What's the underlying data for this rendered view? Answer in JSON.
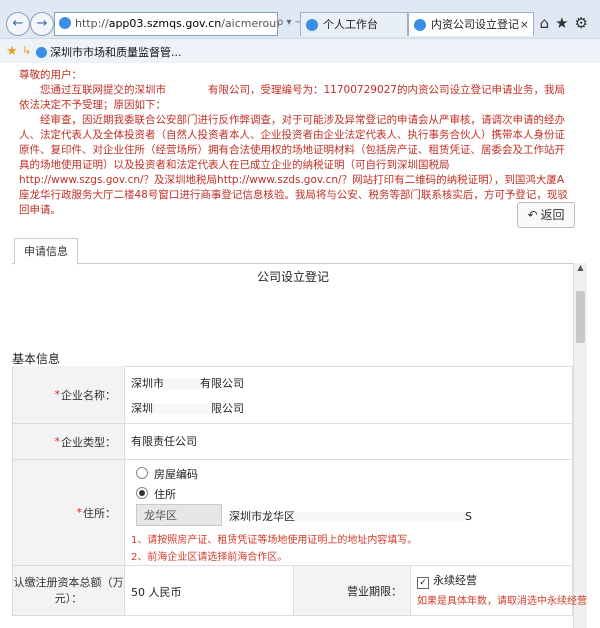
{
  "browser": {
    "back_glyph": "←",
    "forward_glyph": "→",
    "address_prefix": "http://",
    "address_host": "app03.szmqs.gov.cn",
    "address_path": "/aicmerout/jsp/·",
    "address_tools": "ρ ▾ → C",
    "tabs": [
      {
        "label": "个人工作台"
      },
      {
        "label": "内资公司设立登记",
        "active": true
      }
    ],
    "tab_close": "×",
    "toolbar_icons": {
      "home": "⌂",
      "favorites": "★",
      "settings": "⚙"
    },
    "favorites_bar": {
      "star_glyph": "★",
      "add_glyph": "↳",
      "item": "深圳市市场和质量监督管..."
    }
  },
  "notice": {
    "greeting": "尊敬的用户：",
    "lines": [
      "　　您通过互联网提交的深圳市　　　　有限公司，受理编号为：11700729027的内资公司设立登记申请业务，我局依法决定不予受理；原因如下：",
      "　　经审查，因近期我委联合公安部门进行反作弊调查，对于可能涉及异常登记的申请会从严审核，请调次申请的经办人、法定代表人及全体投资者（自然人投资者本人、企业投资者由企业法定代表人、执行事务合伙人）携带本人身份证原件、复印件、对企业住所（经营场所）拥有合法使用权的场地证明材料（包括房产证、租赁凭证、居委会及工作站开具的场地使用证明）以及投资者和法定代表人在已成立企业的纳税证明（可自行到深圳国税局http://www.szgs.gov.cn/？及深圳地税局http://www.szds.gov.cn/？网站打印有二维码的纳税证明），到国鸿大厦A座龙华行政服务大厅二楼48号窗口进行商事登记信息核验。我局将与公安、税务等部门联系核实后，方可予登记，现驳回申请。"
    ]
  },
  "back_button": {
    "icon": "↶",
    "label": "返回"
  },
  "panel_tab": "申请信息",
  "form_title": "公司设立登记",
  "section_title": "基本信息",
  "required_mark": "*",
  "fields": {
    "company_name": {
      "label": "企业名称：",
      "value1_a": "深圳市",
      "value1_b": "有限公司",
      "value2_a": "深圳",
      "value2_b": "限公司"
    },
    "company_type": {
      "label": "企业类型：",
      "value": "有限责任公司"
    },
    "address": {
      "label": "住所：",
      "radio_option1": "房屋编码",
      "radio_option2": "住所",
      "district": "龙华区",
      "address_prefix": "深圳市龙华区",
      "address_suffix": "S",
      "hint1": "1、请按照房产证、租赁凭证等场地使用证明上的地址内容填写。",
      "hint2": "2、前海企业区请选择前海合作区。"
    },
    "capital": {
      "label": "认缴注册资本总额（万元）：",
      "value": "50 人民币"
    },
    "term": {
      "label": "营业期限：",
      "checkbox_label": "永续经营",
      "checked_glyph": "✓",
      "hint": "如果是具体年数，请取消选中永续经营"
    }
  }
}
